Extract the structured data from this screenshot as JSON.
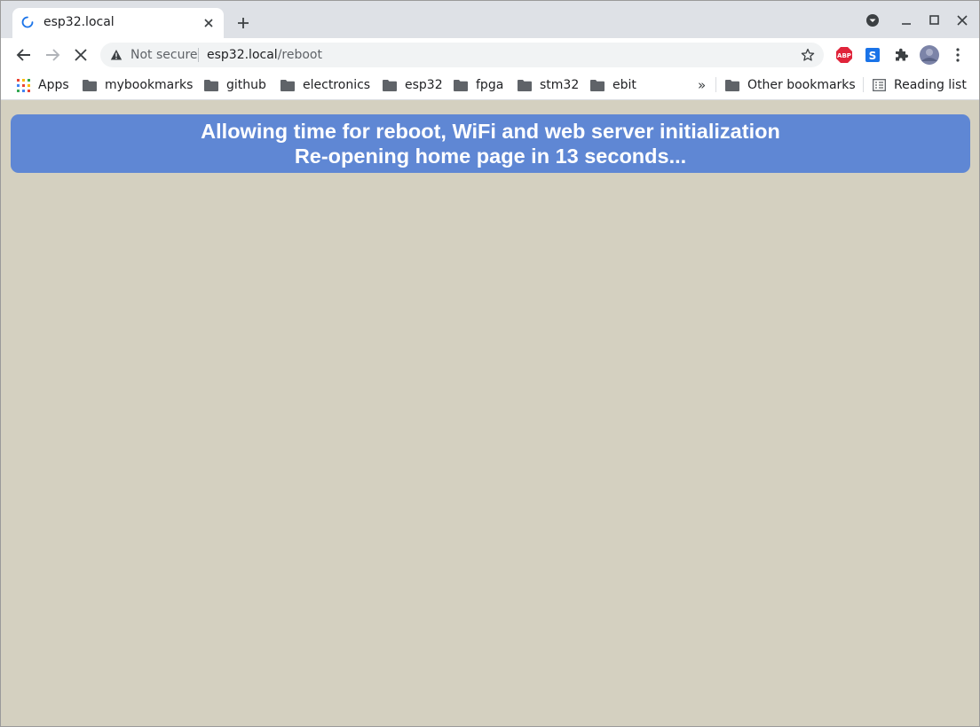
{
  "tab": {
    "title": "esp32.local"
  },
  "address_bar": {
    "security_label": "Not secure",
    "url_host": "esp32.local",
    "url_path": "/reboot"
  },
  "bookmarks": {
    "apps_label": "Apps",
    "items": [
      "mybookmarks",
      "github",
      "electronics",
      "esp32",
      "fpga",
      "stm32",
      "ebit"
    ],
    "overflow_label": "»",
    "other_label": "Other bookmarks",
    "reading_list_label": "Reading list"
  },
  "extensions": {
    "abp_label": "ABP",
    "s_label": "S"
  },
  "page": {
    "line1": "Allowing time for reboot, WiFi and web server initialization",
    "line2": "Re-opening home page in 13 seconds..."
  },
  "colors": {
    "page_background": "#d4d0c0",
    "banner_background": "#5f87d4",
    "banner_text": "#ffffff"
  }
}
